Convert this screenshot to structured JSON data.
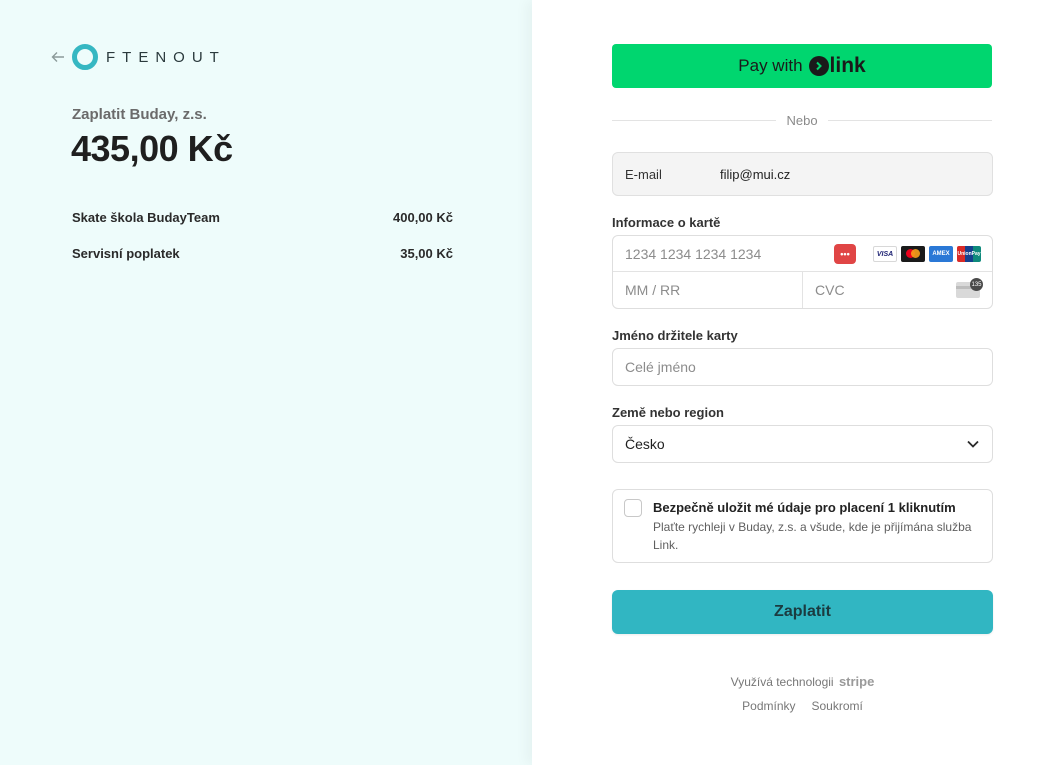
{
  "merchant_panel": {
    "logo_text": "FTENOUT",
    "merchant_label": "Zaplatit Buday, z.s.",
    "total": "435,00 Kč",
    "line_items": [
      {
        "name": "Skate škola BudayTeam",
        "price": "400,00 Kč"
      },
      {
        "name": "Servisní poplatek",
        "price": "35,00 Kč"
      }
    ]
  },
  "checkout": {
    "link_button": {
      "prefix": "Pay with",
      "brand": "link"
    },
    "divider_text": "Nebo",
    "email": {
      "label": "E-mail",
      "value": "filip@mui.cz"
    },
    "card": {
      "label": "Informace o kartě",
      "number_placeholder": "1234 1234 1234 1234",
      "expiry_placeholder": "MM / RR",
      "cvc_placeholder": "CVC",
      "autofill_icon_text": "•••",
      "brand_icons": [
        "visa",
        "mastercard",
        "amex",
        "unionpay"
      ],
      "visa_text": "VISA",
      "amex_text": "AMEX",
      "unionpay_text": "UnionPay",
      "cvc_badge": "135"
    },
    "cardholder": {
      "label": "Jméno držitele karty",
      "placeholder": "Celé jméno"
    },
    "country": {
      "label": "Země nebo region",
      "value": "Česko"
    },
    "save": {
      "title": "Bezpečně uložit mé údaje pro placení 1 kliknutím",
      "description": "Plaťte rychleji v Buday, z.s. a všude, kde je přijímána služba Link.",
      "checked": false
    },
    "pay_button": "Zaplatit",
    "powered_by": "Využívá technologii",
    "powered_brand": "stripe",
    "links": [
      "Podmínky",
      "Soukromí"
    ]
  },
  "colors": {
    "left_bg": "#eefcfb",
    "link_green": "#00d66f",
    "accent": "#31b6c2",
    "logo_ring": "#36b7c2"
  }
}
